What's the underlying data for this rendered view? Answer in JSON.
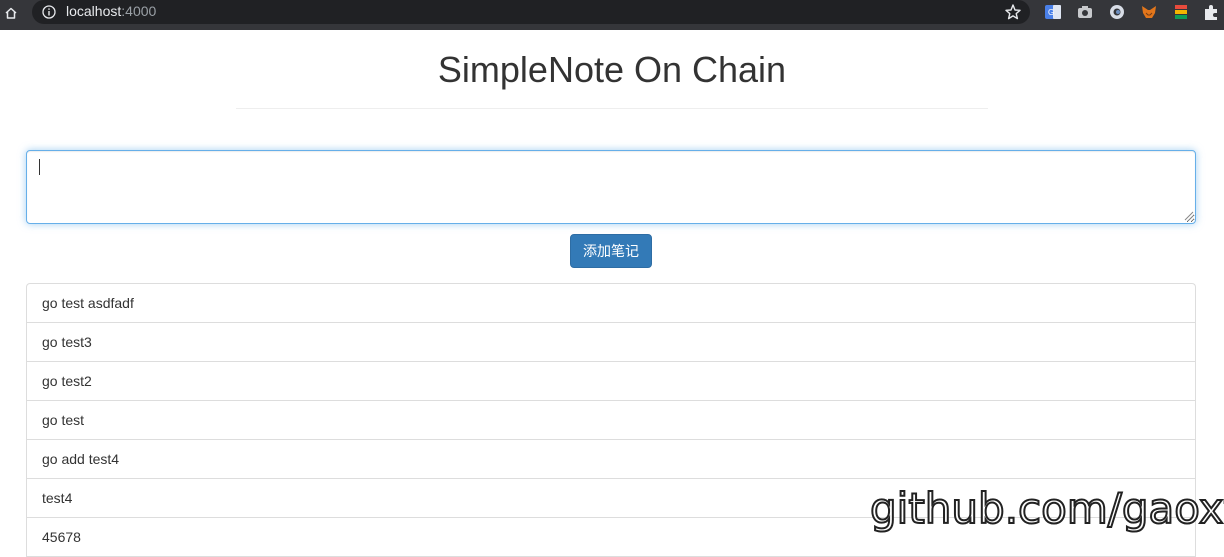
{
  "browser": {
    "url_host": "localhost",
    "url_port": ":4000"
  },
  "page": {
    "title": "SimpleNote On Chain"
  },
  "note_input": {
    "value": "",
    "placeholder": ""
  },
  "add_button": {
    "label": "添加笔记"
  },
  "notes": [
    "go test asdfadf",
    "go test3",
    "go test2",
    "go test",
    "go add test4",
    "test4",
    "45678"
  ],
  "watermark": "github.com/gaoxt",
  "colors": {
    "primary_button": "#337ab7",
    "input_focus_border": "#66afe9",
    "browser_bar": "#35363a"
  }
}
